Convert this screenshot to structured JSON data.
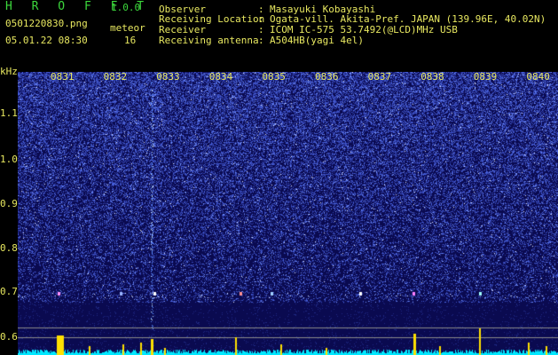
{
  "header": {
    "app_name": "H R O F F T",
    "version": "1.0.0",
    "filename": "0501220830.png",
    "timestamp": "05.01.22 08:30",
    "meteor_label": "meteor",
    "meteor_count": "16"
  },
  "info": [
    {
      "label": "Observer",
      "value": "Masayuki Kobayashi"
    },
    {
      "label": "Receiving Location",
      "value": "Ogata-vill. Akita-Pref. JAPAN (139.96E, 40.02N)"
    },
    {
      "label": "Receiver",
      "value": "ICOM IC-575 53.7492(@LCD)MHz USB"
    },
    {
      "label": "Receiving antenna",
      "value": "A504HB(yagi 4el)"
    }
  ],
  "chart_data": {
    "type": "heatmap",
    "ylabel": "kHz",
    "yticks": [
      "1.1",
      "1.0",
      "0.9",
      "0.8",
      "0.7",
      "0.6"
    ],
    "xticks": [
      "0831",
      "0832",
      "0833",
      "0834",
      "0835",
      "0836",
      "0837",
      "0838",
      "0839",
      "0840"
    ],
    "ylim": [
      0.58,
      1.16
    ],
    "colors": {
      "background": "#0a0a50",
      "noise": "#3f4fd8",
      "signal": "#ffffff",
      "echo": "#ffe000",
      "baseline": "#00e8ff"
    }
  }
}
